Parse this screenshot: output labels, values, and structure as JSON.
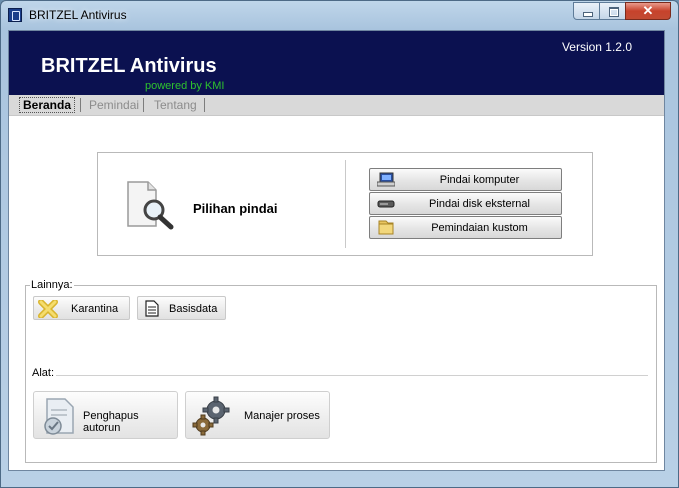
{
  "window": {
    "title": "BRITZEL Antivirus",
    "close_glyph": "✕"
  },
  "banner": {
    "version": "Version 1.2.0",
    "app_name": "BRITZEL Antivirus",
    "powered_by": "powered by KMI",
    "background": "#0b1150",
    "powered_color": "#2ec22e"
  },
  "tabs": [
    {
      "label": "Beranda",
      "active": true
    },
    {
      "label": "Pemindai",
      "active": false
    },
    {
      "label": "Tentang",
      "active": false
    }
  ],
  "scan": {
    "label": "Pilihan pindai",
    "buttons": [
      {
        "label": "Pindai komputer",
        "icon": "computer-icon"
      },
      {
        "label": "Pindai disk eksternal",
        "icon": "drive-icon"
      },
      {
        "label": "Pemindaian kustom",
        "icon": "folder-icon"
      }
    ]
  },
  "others": {
    "legend": "Lainnya:",
    "quarantine_label": "Karantina",
    "database_label": "Basisdata"
  },
  "tools": {
    "label": "Alat:",
    "autorun_label": "Penghapus autorun",
    "process_label": "Manajer proses"
  }
}
